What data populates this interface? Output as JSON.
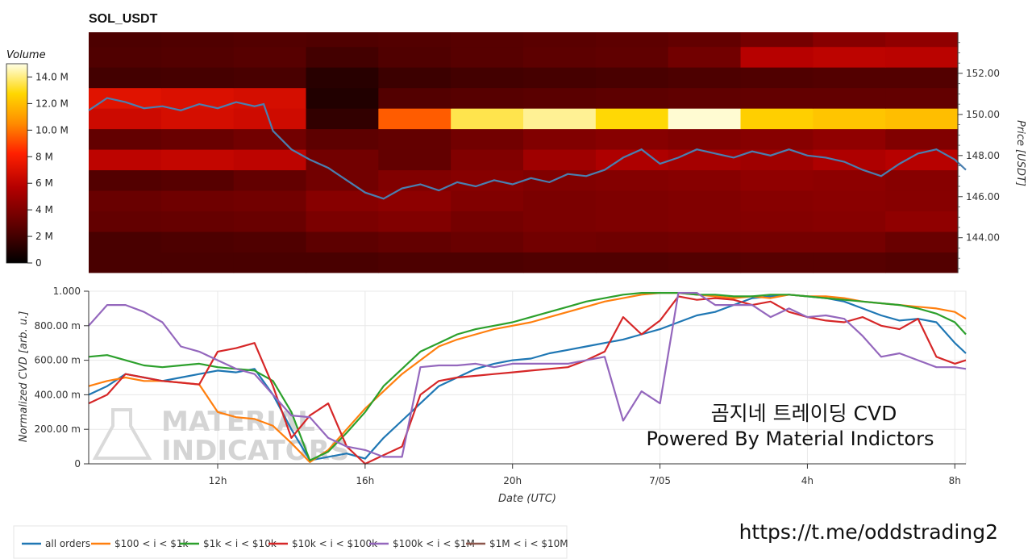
{
  "chart_data": [
    {
      "type": "heatmap",
      "title": "SOL_USDT",
      "ylabel": "Price [USDT]",
      "ylim": [
        142.3,
        154.0
      ],
      "yticks": [
        "144.00",
        "146.00",
        "148.00",
        "150.00",
        "152.00"
      ],
      "colorbar": {
        "title": "Volume",
        "range": [
          0,
          15
        ],
        "ticks": [
          "0",
          "2 M",
          "4 M",
          "6 M",
          "8 M",
          "10.0 M",
          "12.0 M",
          "14.0 M"
        ]
      },
      "price_bands": [
        142.3,
        143.3,
        144.3,
        145.3,
        146.3,
        147.3,
        148.3,
        149.3,
        150.3,
        151.3,
        152.3,
        153.3,
        154.0
      ],
      "band_volume_M": [
        [
          2.2,
          2.2,
          2.2,
          2.2,
          2.3,
          2.3,
          2.4,
          2.4,
          2.5,
          2.6,
          2.6,
          2.5
        ],
        [
          2.2,
          2.3,
          2.4,
          2.8,
          3.0,
          3.2,
          3.5,
          3.4,
          3.5,
          3.6,
          3.6,
          3.2
        ],
        [
          3.0,
          3.1,
          3.2,
          3.8,
          4.0,
          3.6,
          3.8,
          3.9,
          4.0,
          4.1,
          4.2,
          4.5
        ],
        [
          3.2,
          3.4,
          3.5,
          4.2,
          4.4,
          4.0,
          3.8,
          3.9,
          4.0,
          4.2,
          4.3,
          4.2
        ],
        [
          2.5,
          2.6,
          3.0,
          3.5,
          4.0,
          4.2,
          4.0,
          4.1,
          4.2,
          4.5,
          4.4,
          4.2
        ],
        [
          6.0,
          6.2,
          6.0,
          3.5,
          3.0,
          4.0,
          5.0,
          5.5,
          5.2,
          5.0,
          5.5,
          5.8
        ],
        [
          3.0,
          3.2,
          3.5,
          2.8,
          3.0,
          3.5,
          4.0,
          4.2,
          4.0,
          4.2,
          4.5,
          4.0
        ],
        [
          6.5,
          6.8,
          6.6,
          1.5,
          9.5,
          13.5,
          14.2,
          12.8,
          14.8,
          12.5,
          12.2,
          12.0
        ],
        [
          7.2,
          7.0,
          6.8,
          1.0,
          2.5,
          2.6,
          2.7,
          2.8,
          2.9,
          3.0,
          3.0,
          3.0
        ],
        [
          2.0,
          2.1,
          2.2,
          1.2,
          1.8,
          2.0,
          2.1,
          2.2,
          2.3,
          2.4,
          2.5,
          2.5
        ],
        [
          2.4,
          2.5,
          2.6,
          2.0,
          2.4,
          2.6,
          2.8,
          2.9,
          3.5,
          5.8,
          6.0,
          5.9
        ],
        [
          2.3,
          2.4,
          2.5,
          2.4,
          2.5,
          2.6,
          2.7,
          2.8,
          3.0,
          3.6,
          4.2,
          4.5
        ]
      ],
      "time_ticks": [
        "12h",
        "16h",
        "20h",
        "7/05",
        "4h",
        "8h"
      ],
      "price_series": {
        "t_hours": [
          8.5,
          9,
          9.5,
          10,
          10.5,
          11,
          11.5,
          12,
          12.5,
          13,
          13.25,
          13.5,
          14,
          14.5,
          15,
          15.5,
          16,
          16.5,
          17,
          17.5,
          18,
          18.5,
          19,
          19.5,
          20,
          20.5,
          21,
          21.5,
          22,
          22.5,
          23,
          23.5,
          24,
          24.5,
          25,
          25.5,
          26,
          26.5,
          27,
          27.5,
          28,
          28.5,
          29,
          29.5,
          30,
          30.5,
          31,
          31.5,
          32,
          32.3
        ],
        "price": [
          150.2,
          150.8,
          150.6,
          150.3,
          150.4,
          150.2,
          150.5,
          150.3,
          150.6,
          150.4,
          150.5,
          149.2,
          148.3,
          147.8,
          147.4,
          146.8,
          146.2,
          145.9,
          146.4,
          146.6,
          146.3,
          146.7,
          146.5,
          146.8,
          146.6,
          146.9,
          146.7,
          147.1,
          147.0,
          147.3,
          147.9,
          148.3,
          147.6,
          147.9,
          148.3,
          148.1,
          147.9,
          148.2,
          148.0,
          148.3,
          148.0,
          147.9,
          147.7,
          147.3,
          147.0,
          147.6,
          148.1,
          148.3,
          147.8,
          147.3
        ]
      }
    },
    {
      "type": "line",
      "xlabel": "Date (UTC)",
      "ylabel": "Normalized CVD [arb. u.]",
      "ylim": [
        0,
        1.0
      ],
      "yticks": [
        "0",
        "200.00 m",
        "400.00 m",
        "600.00 m",
        "800.00 m",
        "1.000"
      ],
      "xticks": [
        "12h",
        "16h",
        "20h",
        "7/05",
        "4h",
        "8h"
      ],
      "x_hours": [
        8.5,
        9,
        9.5,
        10,
        10.5,
        11,
        11.5,
        12,
        12.5,
        13,
        13.5,
        14,
        14.5,
        15,
        15.5,
        16,
        16.5,
        17,
        17.5,
        18,
        18.5,
        19,
        19.5,
        20,
        20.5,
        21,
        21.5,
        22,
        22.5,
        23,
        23.5,
        24,
        24.5,
        25,
        25.5,
        26,
        26.5,
        27,
        27.5,
        28,
        28.5,
        29,
        29.5,
        30,
        30.5,
        31,
        31.5,
        32,
        32.3
      ],
      "series": [
        {
          "name": "all orders",
          "color": "#1f77b4",
          "values": [
            0.4,
            0.45,
            0.52,
            0.5,
            0.48,
            0.5,
            0.52,
            0.54,
            0.53,
            0.55,
            0.4,
            0.2,
            0.02,
            0.04,
            0.06,
            0.03,
            0.15,
            0.25,
            0.35,
            0.45,
            0.5,
            0.55,
            0.58,
            0.6,
            0.61,
            0.64,
            0.66,
            0.68,
            0.7,
            0.72,
            0.75,
            0.78,
            0.82,
            0.86,
            0.88,
            0.92,
            0.96,
            0.97,
            0.98,
            0.97,
            0.96,
            0.94,
            0.9,
            0.86,
            0.83,
            0.84,
            0.82,
            0.7,
            0.64
          ]
        },
        {
          "name": "$100 < i < $1k",
          "color": "#ff7f0e",
          "values": [
            0.45,
            0.48,
            0.5,
            0.48,
            0.48,
            0.47,
            0.46,
            0.3,
            0.27,
            0.26,
            0.22,
            0.12,
            0.01,
            0.08,
            0.2,
            0.32,
            0.42,
            0.52,
            0.6,
            0.68,
            0.72,
            0.75,
            0.78,
            0.8,
            0.82,
            0.85,
            0.88,
            0.91,
            0.94,
            0.96,
            0.98,
            0.99,
            0.99,
            0.98,
            0.97,
            0.96,
            0.97,
            0.96,
            0.98,
            0.97,
            0.97,
            0.96,
            0.94,
            0.93,
            0.92,
            0.91,
            0.9,
            0.88,
            0.84
          ]
        },
        {
          "name": "$1k < i < $10k",
          "color": "#2ca02c",
          "values": [
            0.62,
            0.63,
            0.6,
            0.57,
            0.56,
            0.57,
            0.58,
            0.56,
            0.55,
            0.54,
            0.48,
            0.3,
            0.02,
            0.07,
            0.18,
            0.3,
            0.45,
            0.55,
            0.65,
            0.7,
            0.75,
            0.78,
            0.8,
            0.82,
            0.85,
            0.88,
            0.91,
            0.94,
            0.96,
            0.98,
            0.99,
            0.99,
            0.99,
            0.98,
            0.98,
            0.97,
            0.97,
            0.98,
            0.98,
            0.97,
            0.96,
            0.95,
            0.94,
            0.93,
            0.92,
            0.9,
            0.87,
            0.82,
            0.75
          ]
        },
        {
          "name": "$10k < i < $100k",
          "color": "#d62728",
          "values": [
            0.35,
            0.4,
            0.52,
            0.5,
            0.48,
            0.47,
            0.46,
            0.65,
            0.67,
            0.7,
            0.45,
            0.15,
            0.28,
            0.35,
            0.1,
            0.0,
            0.05,
            0.1,
            0.4,
            0.48,
            0.5,
            0.51,
            0.52,
            0.53,
            0.54,
            0.55,
            0.56,
            0.6,
            0.65,
            0.85,
            0.75,
            0.83,
            0.97,
            0.95,
            0.96,
            0.95,
            0.92,
            0.94,
            0.88,
            0.85,
            0.83,
            0.82,
            0.85,
            0.8,
            0.78,
            0.84,
            0.62,
            0.58,
            0.6
          ]
        },
        {
          "name": "$100k < i < $1M",
          "color": "#9467bd",
          "values": [
            0.8,
            0.92,
            0.92,
            0.88,
            0.82,
            0.68,
            0.65,
            0.6,
            0.55,
            0.52,
            0.4,
            0.28,
            0.27,
            0.15,
            0.1,
            0.08,
            0.04,
            0.04,
            0.56,
            0.57,
            0.57,
            0.58,
            0.56,
            0.58,
            0.58,
            0.58,
            0.58,
            0.6,
            0.62,
            0.25,
            0.42,
            0.35,
            0.99,
            0.99,
            0.92,
            0.92,
            0.92,
            0.85,
            0.9,
            0.85,
            0.86,
            0.84,
            0.74,
            0.62,
            0.64,
            0.6,
            0.56,
            0.56,
            0.55
          ]
        },
        {
          "name": "$1M < i < $10M",
          "color": "#8c564b",
          "values": []
        }
      ]
    }
  ],
  "overlay": {
    "line1": "곰지네 트레이딩 CVD",
    "line2": "Powered By Material Indictors"
  },
  "watermark": {
    "line1": "MATERIAL",
    "line2": "INDICATORS"
  },
  "link": "https://t.me/oddstrading2"
}
